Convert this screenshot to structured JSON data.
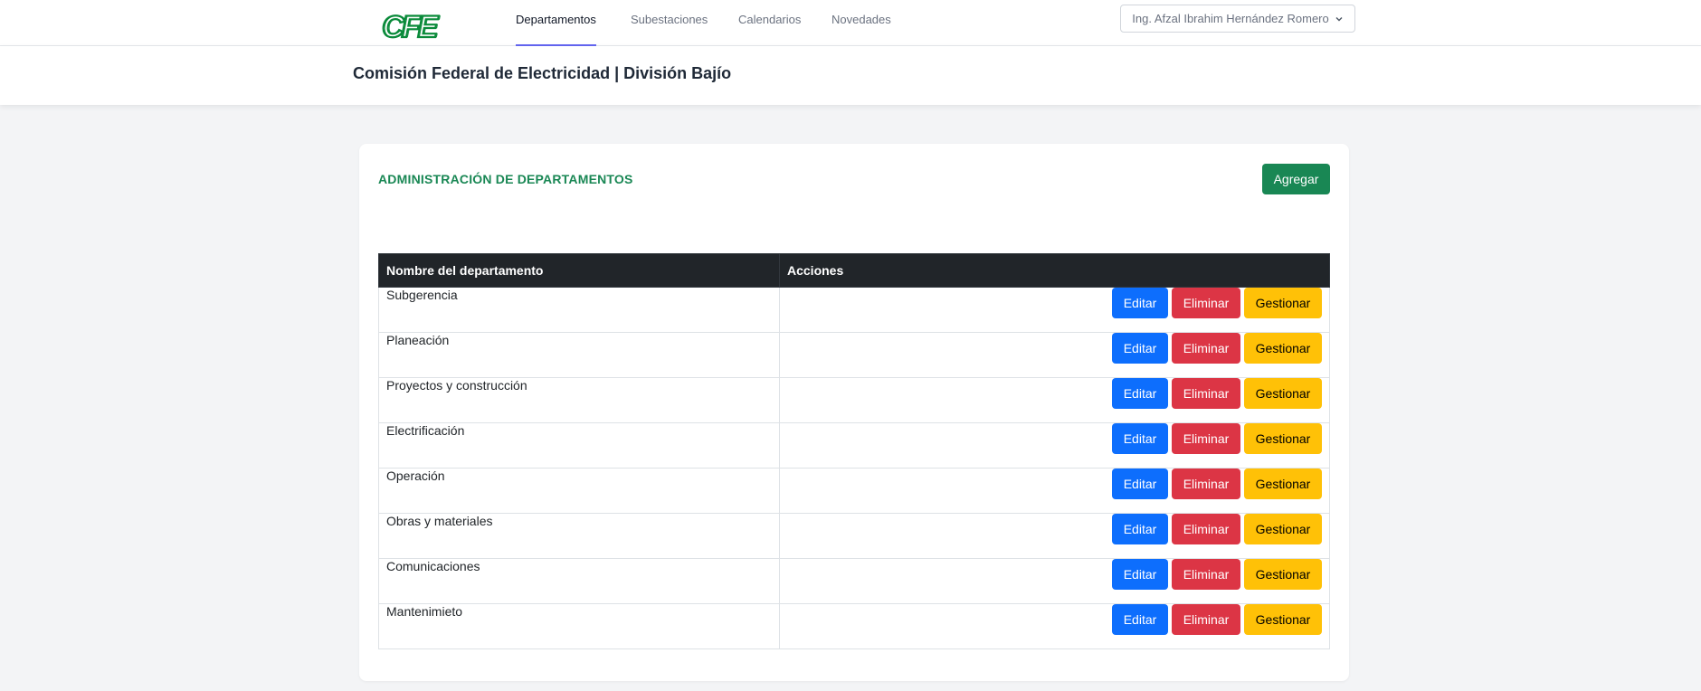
{
  "nav": {
    "logo_text": "CFE",
    "links": [
      "Departamentos",
      "Subestaciones",
      "Calendarios",
      "Novedades"
    ],
    "user": "Ing. Afzal Ibrahim Hernández Romero"
  },
  "header": {
    "title": "Comisión Federal de Electricidad | División Bajío"
  },
  "card": {
    "title": "ADMINISTRACIÓN DE DEPARTAMENTOS",
    "add_label": "Agregar",
    "columns": [
      "Nombre del departamento",
      "Acciones"
    ],
    "rows": [
      "Subgerencia",
      "Planeación",
      "Proyectos y construcción",
      "Electrificación",
      "Operación",
      "Obras y materiales",
      "Comunicaciones",
      "Mantenimieto"
    ],
    "actions": {
      "edit": "Editar",
      "delete": "Eliminar",
      "manage": "Gestionar"
    }
  },
  "colors": {
    "brand_green": "#198754",
    "edit_blue": "#0d6efd",
    "delete_red": "#dc3545",
    "manage_yellow": "#ffc107",
    "header_dark": "#212529"
  }
}
